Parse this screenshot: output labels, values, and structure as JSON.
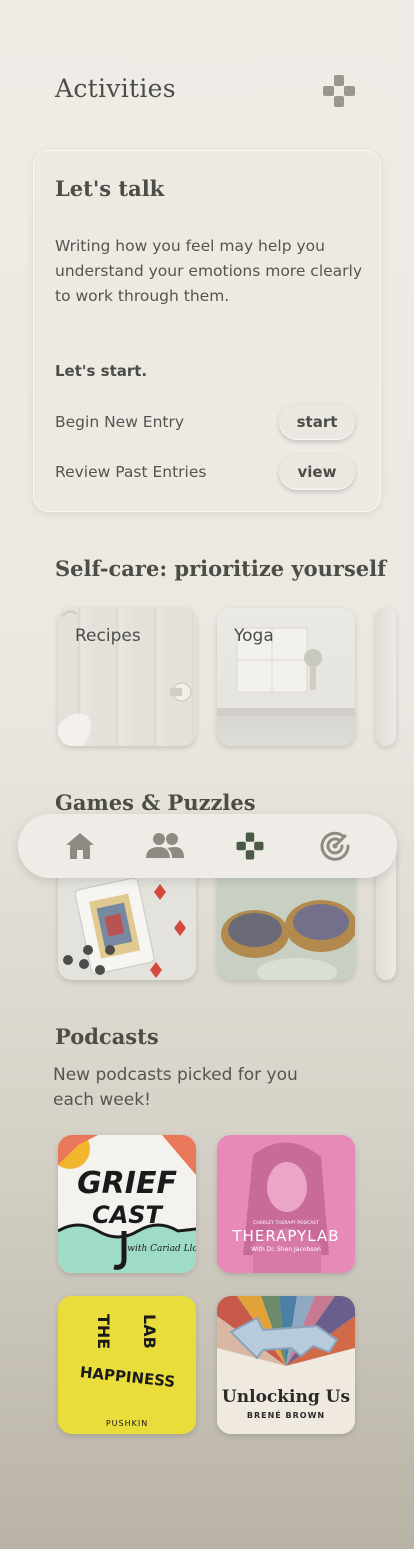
{
  "header": {
    "title": "Activities",
    "icon": "gamepad-icon"
  },
  "talk": {
    "title": "Let's talk",
    "description": "Writing how you feel may help you understand your emotions more clearly to work through them.",
    "start_label": "Let's start.",
    "rows": [
      {
        "label": "Begin New Entry",
        "button": "start"
      },
      {
        "label": "Review Past Entries",
        "button": "view"
      }
    ]
  },
  "selfcare": {
    "title": "Self-care: prioritize yourself",
    "tiles": [
      {
        "label": "Recipes"
      },
      {
        "label": "Yoga"
      }
    ]
  },
  "games": {
    "title": "Games & Puzzles"
  },
  "nav": {
    "items": [
      "home-icon",
      "people-icon",
      "gamepad-icon",
      "target-icon"
    ],
    "active": 2
  },
  "podcasts": {
    "title": "Podcasts",
    "subtitle": "New podcasts picked for you each week!",
    "items": [
      {
        "name": "griefcast",
        "line1": "GRIEF",
        "line2": "CAST",
        "byline": "with Cariad Lloyd"
      },
      {
        "name": "therapy-lab",
        "small": "CHARLEY THERAPY PODCAST",
        "title": "THERAPYLAB",
        "byline": "With Dr. Shen Jacobson"
      },
      {
        "name": "happiness-lab",
        "word1": "THE",
        "word2": "LAB",
        "word3": "HAPPINESS",
        "publisher": "PUSHKIN"
      },
      {
        "name": "unlocking-us",
        "title": "Unlocking Us",
        "author": "BRENÉ BROWN"
      }
    ]
  },
  "colors": {
    "background": "#ebe8e1",
    "text": "#4d4d47",
    "accent_active": "#4a5a44",
    "nav_inactive": "#8d8b82"
  }
}
